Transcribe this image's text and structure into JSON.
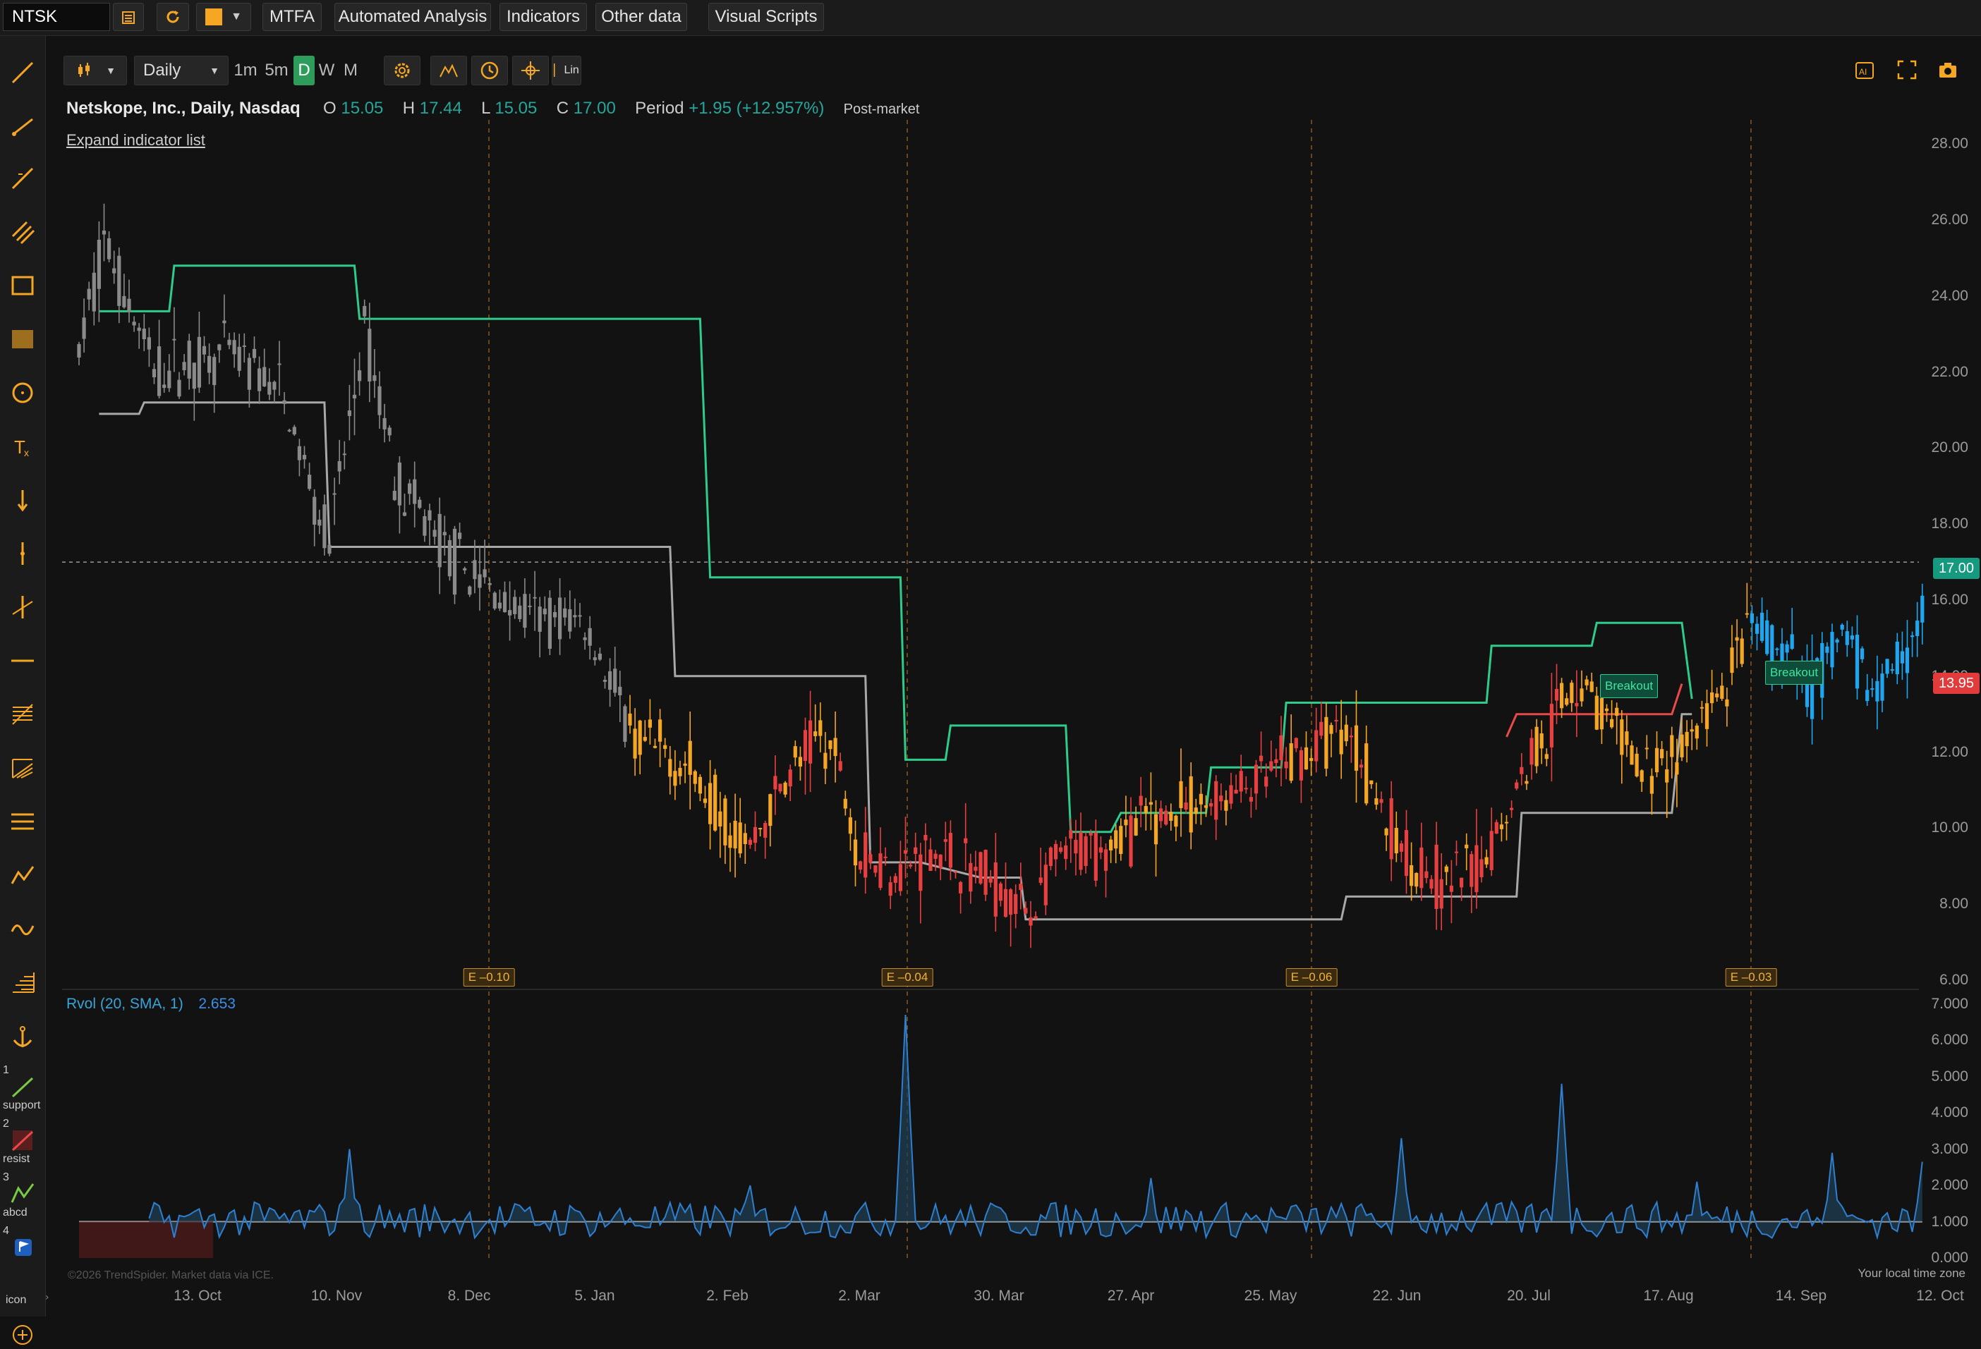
{
  "topbar": {
    "symbol": "NTSK",
    "mtfa": "MTFA",
    "automated_analysis": "Automated Analysis",
    "indicators": "Indicators",
    "other_data": "Other data",
    "visual_scripts": "Visual Scripts",
    "color_swatch": "#f5a623"
  },
  "left_tools": {
    "favorites": [
      {
        "num": "1",
        "label": "support"
      },
      {
        "num": "2",
        "label": "resist"
      },
      {
        "num": "3",
        "label": "abcd"
      },
      {
        "num": "4",
        "label": "icon"
      }
    ]
  },
  "chart_toolbar": {
    "interval": "Daily",
    "tf_1m": "1m",
    "tf_5m": "5m",
    "tf_d": "D",
    "tf_w": "W",
    "tf_m": "M",
    "lin": "Lin"
  },
  "legend": {
    "name": "Netskope, Inc., Daily, Nasdaq",
    "o_label": "O",
    "o_value": "15.05",
    "h_label": "H",
    "h_value": "17.44",
    "l_label": "L",
    "l_value": "15.05",
    "c_label": "C",
    "c_value": "17.00",
    "period_label": "Period",
    "period_value": "+1.95 (+12.957%)",
    "session": "Post-market",
    "expand": "Expand indicator list"
  },
  "rvol": {
    "label": "Rvol (20, SMA, 1)",
    "value": "2.653"
  },
  "price_tags": {
    "last": "17.00",
    "level": "13.95"
  },
  "breakouts": [
    "Breakout",
    "Breakout"
  ],
  "earnings": [
    "E –0.10",
    "E –0.04",
    "E –0.06",
    "E –0.03"
  ],
  "footer": {
    "copyright": "©2026 TrendSpider. Market data via ICE.",
    "timezone": "Your local time zone"
  },
  "colors": {
    "green_line": "#2ecc8a",
    "gray_line": "#a8a8a8",
    "red_line": "#e84a4a",
    "candle_gray": "#8a8a8a",
    "candle_orange": "#f5a623",
    "candle_red": "#e84040",
    "candle_blue": "#1ea7f0",
    "rvol_line": "#2f7fd0"
  },
  "chart_data": {
    "type": "candlestick",
    "y_axis": {
      "ticks": [
        "28.00",
        "26.00",
        "24.00",
        "22.00",
        "20.00",
        "18.00",
        "16.00",
        "14.00",
        "12.00",
        "10.00",
        "8.00",
        "6.00"
      ],
      "range": [
        6,
        28.6
      ]
    },
    "rvol_axis": {
      "ticks": [
        "7.000",
        "6.000",
        "5.000",
        "4.000",
        "3.000",
        "2.000",
        "1.000",
        "0.000"
      ],
      "range": [
        0,
        7
      ]
    },
    "x_axis": {
      "ticks": [
        "13. Oct",
        "10. Nov",
        "8. Dec",
        "5. Jan",
        "2. Feb",
        "2. Mar",
        "30. Mar",
        "27. Apr",
        "25. May",
        "22. Jun",
        "20. Jul",
        "17. Aug",
        "14. Sep",
        "12. Oct"
      ]
    },
    "trend_segments": [
      {
        "color": "green_line",
        "points": [
          [
            4,
            23.6
          ],
          [
            18,
            23.6
          ],
          [
            19,
            24.8
          ],
          [
            55,
            24.8
          ],
          [
            56,
            23.4
          ],
          [
            124,
            23.4
          ],
          [
            126,
            16.6
          ],
          [
            164,
            16.6
          ],
          [
            165,
            11.8
          ],
          [
            173,
            11.8
          ],
          [
            174,
            12.7
          ],
          [
            197,
            12.7
          ],
          [
            198,
            9.9
          ],
          [
            206,
            9.9
          ],
          [
            208,
            10.4
          ],
          [
            225,
            10.4
          ],
          [
            226,
            11.6
          ],
          [
            237,
            11.6
          ],
          [
            239,
            11.6
          ],
          [
            240,
            11.6
          ],
          [
            241,
            13.3
          ],
          [
            281,
            13.3
          ],
          [
            282,
            14.8
          ],
          [
            302,
            14.8
          ],
          [
            303,
            15.4
          ],
          [
            320,
            15.4
          ],
          [
            322,
            13.4
          ]
        ]
      },
      {
        "color": "gray_line",
        "points": [
          [
            4,
            20.9
          ],
          [
            12,
            20.9
          ],
          [
            13,
            21.2
          ],
          [
            49,
            21.2
          ],
          [
            50,
            17.4
          ],
          [
            118,
            17.4
          ],
          [
            119,
            14.0
          ],
          [
            157,
            14.0
          ],
          [
            158,
            9.1
          ],
          [
            168,
            9.1
          ],
          [
            180,
            8.7
          ],
          [
            188,
            8.7
          ],
          [
            189,
            7.6
          ],
          [
            237,
            7.6
          ],
          [
            252,
            7.6
          ],
          [
            253,
            8.2
          ],
          [
            287,
            8.2
          ],
          [
            288,
            10.4
          ],
          [
            318,
            10.4
          ],
          [
            320,
            13.0
          ],
          [
            322,
            13.0
          ]
        ]
      },
      {
        "color": "red_line",
        "points": [
          [
            285,
            12.4
          ],
          [
            287,
            13.0
          ],
          [
            318,
            13.0
          ],
          [
            320,
            13.8
          ]
        ]
      }
    ],
    "last_close": 17.0,
    "volume_baseline": 1.0
  }
}
